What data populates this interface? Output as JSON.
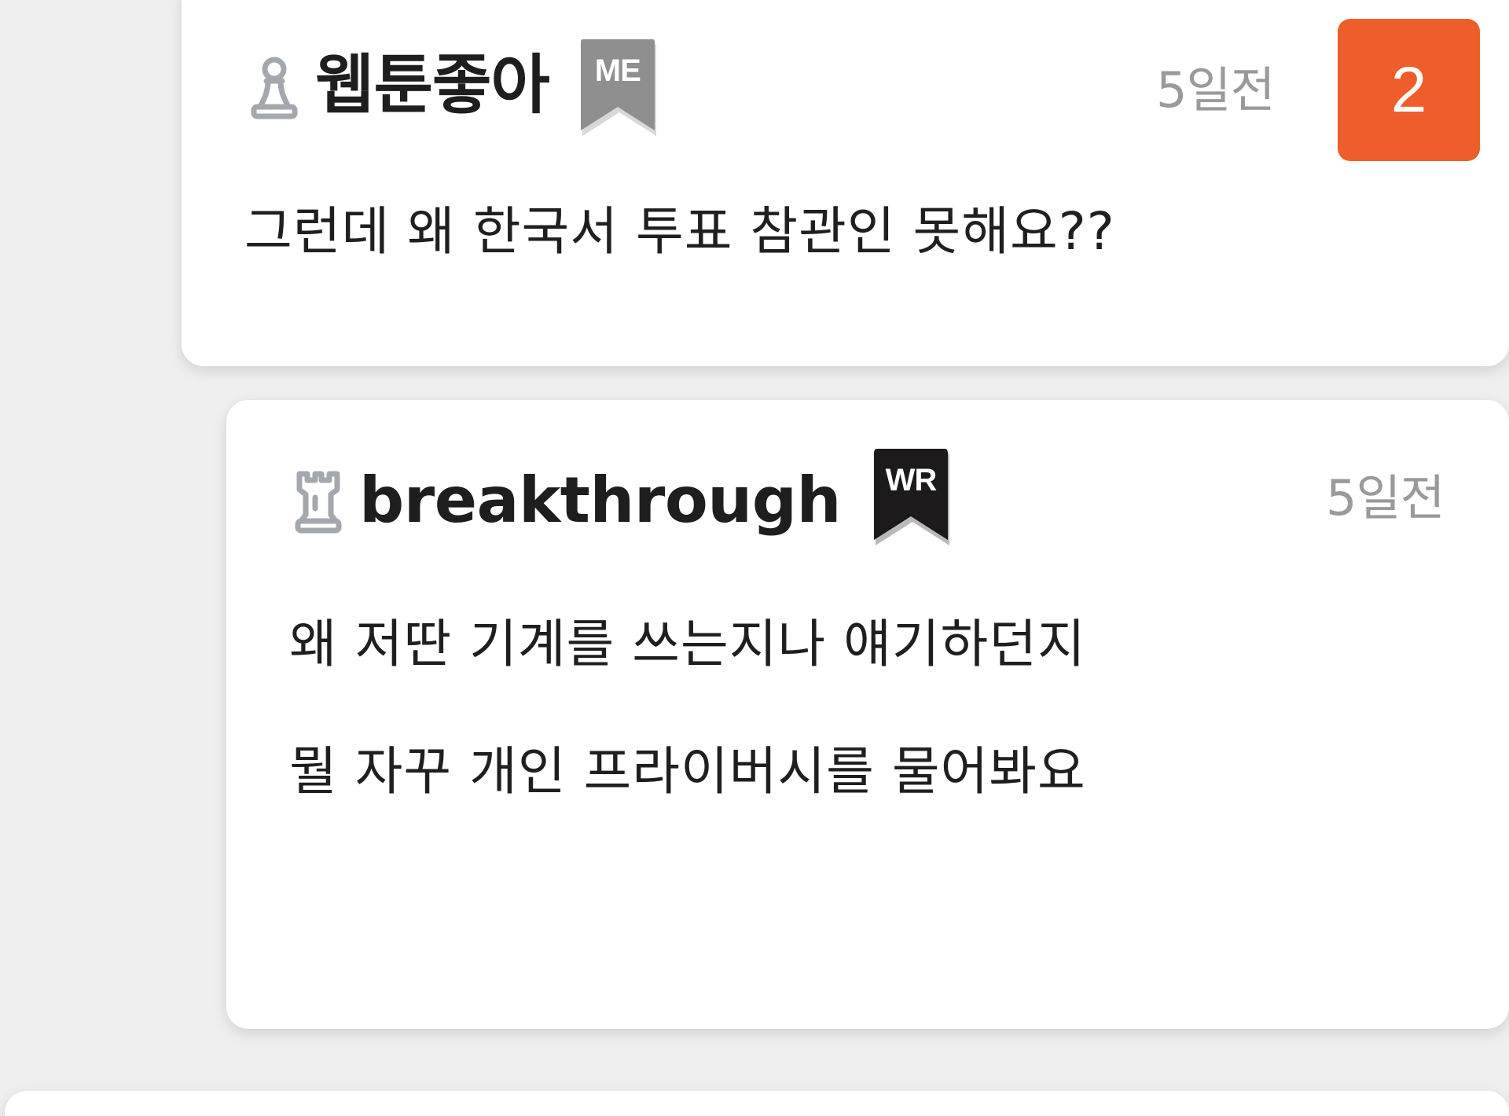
{
  "comments": [
    {
      "username": "웹툰좋아",
      "role_badge": "ME",
      "role_badge_color": "#8f8f8f",
      "rank_icon": "pawn-icon",
      "time": "5일전",
      "reply_count": "2",
      "reply_count_color": "#ee5e2a",
      "body": [
        "그런데 왜 한국서 투표 참관인 못해요??"
      ]
    },
    {
      "username": "breakthrough",
      "role_badge": "WR",
      "role_badge_color": "#1c1a1a",
      "rank_icon": "rook-icon",
      "time": "5일전",
      "body": [
        "왜 저딴 기계를 쓰는지나 얘기하던지",
        "뭘 자꾸 개인 프라이버시를 물어봐요"
      ]
    }
  ]
}
